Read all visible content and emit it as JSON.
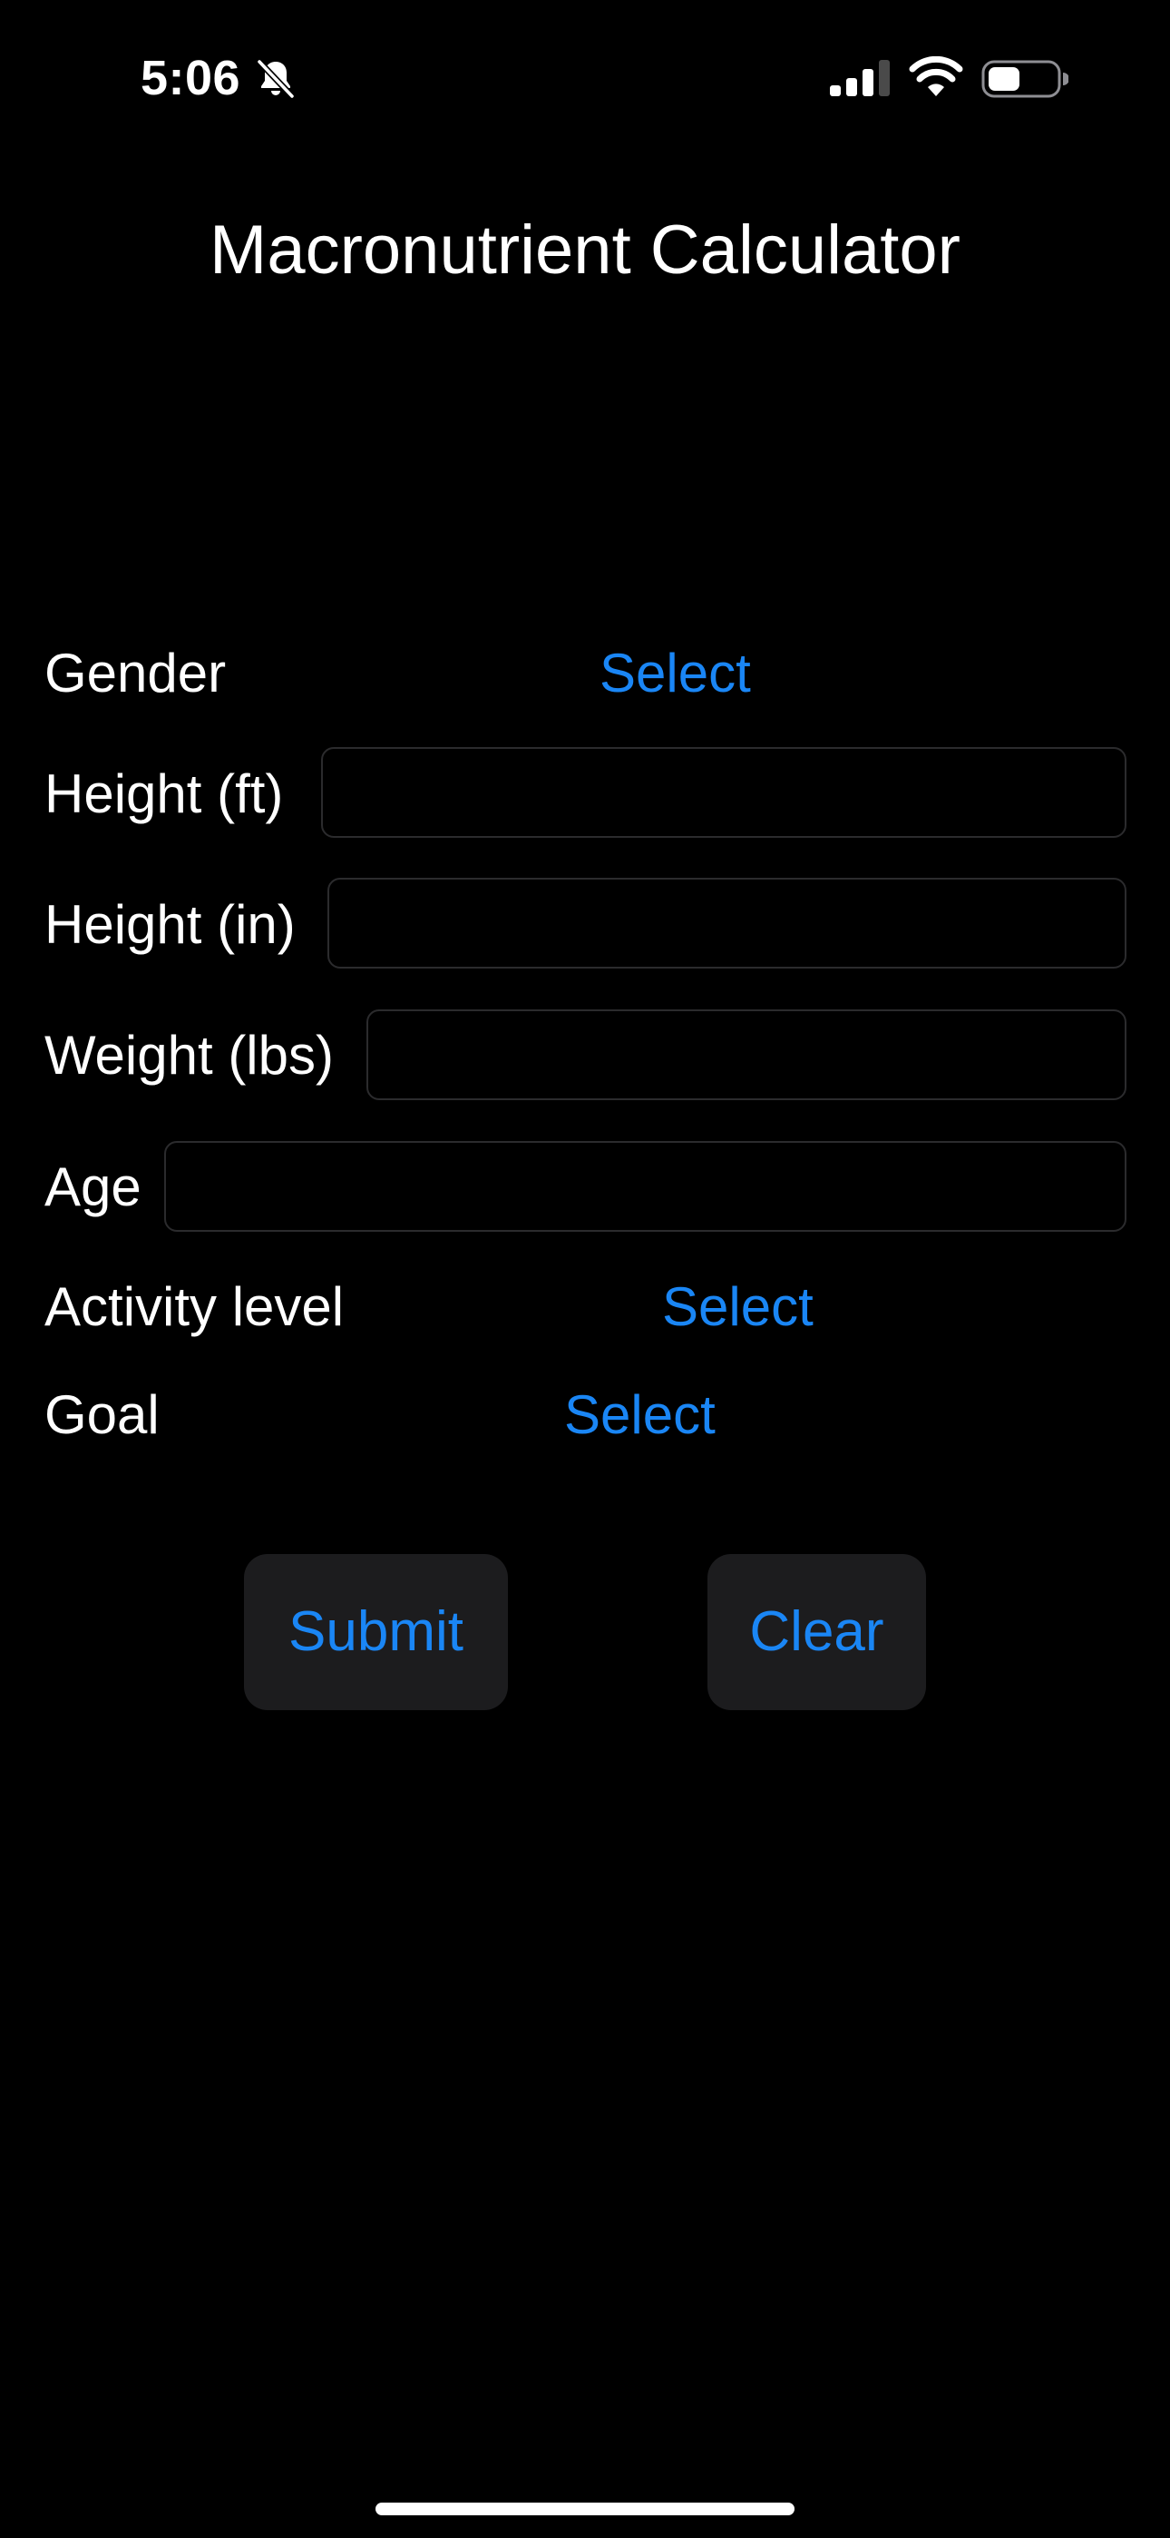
{
  "status_bar": {
    "time": "5:06",
    "icons": [
      "bell-slash-icon",
      "cellular-signal-icon",
      "wifi-icon",
      "battery-icon"
    ]
  },
  "title": "Macronutrient Calculator",
  "form": {
    "gender": {
      "label": "Gender",
      "picker": "Select"
    },
    "height_ft": {
      "label": "Height (ft)",
      "value": ""
    },
    "height_in": {
      "label": "Height (in)",
      "value": ""
    },
    "weight": {
      "label": "Weight (lbs)",
      "value": ""
    },
    "age": {
      "label": "Age",
      "value": ""
    },
    "activity_level": {
      "label": "Activity level",
      "picker": "Select"
    },
    "goal": {
      "label": "Goal",
      "picker": "Select"
    }
  },
  "buttons": {
    "submit": "Submit",
    "clear": "Clear"
  },
  "colors": {
    "background": "#000000",
    "text": "#ffffff",
    "accent": "#1a86f5",
    "button_bg": "#1c1c1e",
    "field_border": "#2b2b2d"
  }
}
